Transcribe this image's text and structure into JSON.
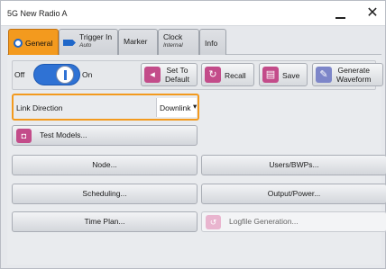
{
  "window": {
    "title": "5G New Radio A",
    "minimize_label": "",
    "close_label": "✕"
  },
  "tabs": [
    {
      "label": "General"
    },
    {
      "label": "Trigger In",
      "sub": "Auto"
    },
    {
      "label": "Marker"
    },
    {
      "label": "Clock",
      "sub": "Internal"
    },
    {
      "label": "Info"
    }
  ],
  "state_toggle": {
    "off_label": "Off",
    "on_label": "On",
    "value": "On"
  },
  "toolbar": {
    "set_default_line1": "Set To",
    "set_default_line2": "Default",
    "recall_label": "Recall",
    "save_label": "Save",
    "generate_line1": "Generate",
    "generate_line2": "Waveform"
  },
  "link_direction": {
    "label": "Link Direction",
    "value": "Downlink"
  },
  "buttons": {
    "test_models": "Test Models...",
    "node": "Node...",
    "users_bwps": "Users/BWPs...",
    "scheduling": "Scheduling...",
    "output_power": "Output/Power...",
    "time_plan": "Time Plan...",
    "logfile_generation": "Logfile Generation..."
  },
  "colors": {
    "accent_orange": "#f39a1e",
    "toggle_blue": "#2f72d4",
    "icon_magenta": "#c34c8a"
  }
}
